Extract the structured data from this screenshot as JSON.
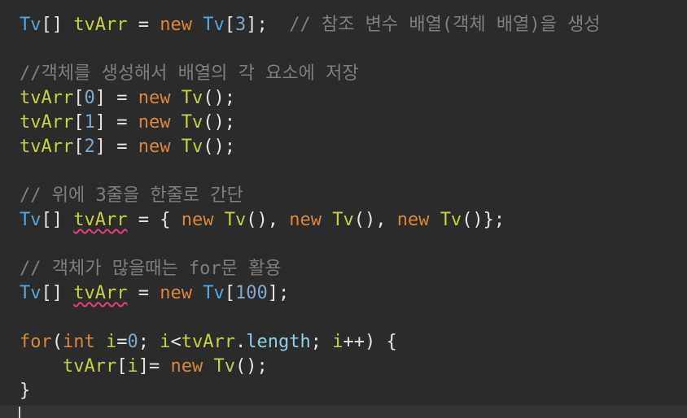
{
  "lines": [
    {
      "tokens": [
        {
          "t": "Tv",
          "c": "type"
        },
        {
          "t": "[] ",
          "c": "pl"
        },
        {
          "t": "tvArr",
          "c": "var"
        },
        {
          "t": " = ",
          "c": "pl"
        },
        {
          "t": "new",
          "c": "kw"
        },
        {
          "t": " ",
          "c": "pl"
        },
        {
          "t": "Tv",
          "c": "type"
        },
        {
          "t": "[",
          "c": "pl"
        },
        {
          "t": "3",
          "c": "num"
        },
        {
          "t": "];  ",
          "c": "pl"
        },
        {
          "t": "// 참조 변수 배열(객체 배열)을 생성",
          "c": "cm"
        }
      ]
    },
    {
      "tokens": []
    },
    {
      "tokens": [
        {
          "t": "//객체를 생성해서 배열의 각 요소에 저장",
          "c": "cm"
        }
      ]
    },
    {
      "tokens": [
        {
          "t": "tvArr",
          "c": "var"
        },
        {
          "t": "[",
          "c": "pl"
        },
        {
          "t": "0",
          "c": "num"
        },
        {
          "t": "] = ",
          "c": "pl"
        },
        {
          "t": "new",
          "c": "kw"
        },
        {
          "t": " ",
          "c": "pl"
        },
        {
          "t": "Tv",
          "c": "var"
        },
        {
          "t": "();",
          "c": "pl"
        }
      ]
    },
    {
      "tokens": [
        {
          "t": "tvArr",
          "c": "var"
        },
        {
          "t": "[",
          "c": "pl"
        },
        {
          "t": "1",
          "c": "num"
        },
        {
          "t": "] = ",
          "c": "pl"
        },
        {
          "t": "new",
          "c": "kw"
        },
        {
          "t": " ",
          "c": "pl"
        },
        {
          "t": "Tv",
          "c": "var"
        },
        {
          "t": "();",
          "c": "pl"
        }
      ]
    },
    {
      "tokens": [
        {
          "t": "tvArr",
          "c": "var"
        },
        {
          "t": "[",
          "c": "pl"
        },
        {
          "t": "2",
          "c": "num"
        },
        {
          "t": "] = ",
          "c": "pl"
        },
        {
          "t": "new",
          "c": "kw"
        },
        {
          "t": " ",
          "c": "pl"
        },
        {
          "t": "Tv",
          "c": "var"
        },
        {
          "t": "();",
          "c": "pl"
        }
      ]
    },
    {
      "tokens": []
    },
    {
      "tokens": [
        {
          "t": "// 위에 3줄을 한줄로 간단",
          "c": "cm"
        }
      ]
    },
    {
      "tokens": [
        {
          "t": "Tv",
          "c": "type"
        },
        {
          "t": "[] ",
          "c": "pl"
        },
        {
          "t": "tvArr",
          "c": "var",
          "sq": true
        },
        {
          "t": " = { ",
          "c": "pl"
        },
        {
          "t": "new",
          "c": "kw"
        },
        {
          "t": " ",
          "c": "pl"
        },
        {
          "t": "Tv",
          "c": "var"
        },
        {
          "t": "(), ",
          "c": "pl"
        },
        {
          "t": "new",
          "c": "kw"
        },
        {
          "t": " ",
          "c": "pl"
        },
        {
          "t": "Tv",
          "c": "var"
        },
        {
          "t": "(), ",
          "c": "pl"
        },
        {
          "t": "new",
          "c": "kw"
        },
        {
          "t": " ",
          "c": "pl"
        },
        {
          "t": "Tv",
          "c": "var"
        },
        {
          "t": "()};",
          "c": "pl"
        }
      ]
    },
    {
      "tokens": []
    },
    {
      "tokens": [
        {
          "t": "// 객체가 많을때는 for문 활용",
          "c": "cm"
        }
      ]
    },
    {
      "tokens": [
        {
          "t": "Tv",
          "c": "type"
        },
        {
          "t": "[] ",
          "c": "pl"
        },
        {
          "t": "tvArr",
          "c": "var",
          "sq": true
        },
        {
          "t": " = ",
          "c": "pl"
        },
        {
          "t": "new",
          "c": "kw"
        },
        {
          "t": " ",
          "c": "pl"
        },
        {
          "t": "Tv",
          "c": "type"
        },
        {
          "t": "[",
          "c": "pl"
        },
        {
          "t": "100",
          "c": "num"
        },
        {
          "t": "];",
          "c": "pl"
        }
      ]
    },
    {
      "tokens": []
    },
    {
      "tokens": [
        {
          "t": "for",
          "c": "kw"
        },
        {
          "t": "(",
          "c": "pl"
        },
        {
          "t": "int",
          "c": "kw"
        },
        {
          "t": " ",
          "c": "pl"
        },
        {
          "t": "i",
          "c": "var"
        },
        {
          "t": "=",
          "c": "pl"
        },
        {
          "t": "0",
          "c": "num"
        },
        {
          "t": "; ",
          "c": "pl"
        },
        {
          "t": "i",
          "c": "var"
        },
        {
          "t": "<",
          "c": "pl"
        },
        {
          "t": "tvArr",
          "c": "var"
        },
        {
          "t": ".",
          "c": "pl"
        },
        {
          "t": "length",
          "c": "fld"
        },
        {
          "t": "; ",
          "c": "pl"
        },
        {
          "t": "i",
          "c": "var"
        },
        {
          "t": "++) {",
          "c": "pl"
        }
      ]
    },
    {
      "tokens": [
        {
          "t": "    ",
          "c": "pl"
        },
        {
          "t": "tvArr",
          "c": "var"
        },
        {
          "t": "[",
          "c": "pl"
        },
        {
          "t": "i",
          "c": "var"
        },
        {
          "t": "]= ",
          "c": "pl"
        },
        {
          "t": "new",
          "c": "kw"
        },
        {
          "t": " ",
          "c": "pl"
        },
        {
          "t": "Tv",
          "c": "var"
        },
        {
          "t": "();",
          "c": "pl"
        }
      ]
    },
    {
      "tokens": [
        {
          "t": "}",
          "c": "pl"
        }
      ]
    }
  ]
}
